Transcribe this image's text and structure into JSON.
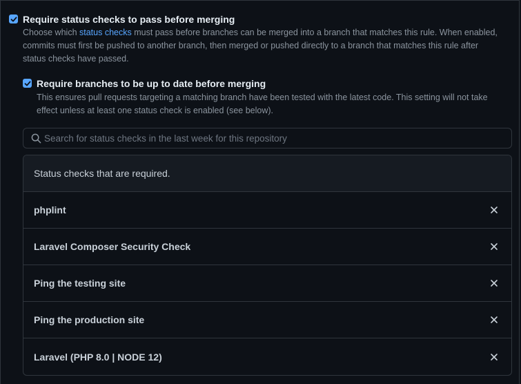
{
  "require_status_checks": {
    "checked": true,
    "title": "Require status checks to pass before merging",
    "desc_prefix": "Choose which ",
    "desc_link": "status checks",
    "desc_line1_rest": " must pass before branches can be merged into a branch that matches this rule. When enabled,",
    "desc_line2": "commits must first be pushed to another branch, then merged or pushed directly to a branch that matches this rule after",
    "desc_line3": "status checks have passed."
  },
  "require_up_to_date": {
    "checked": true,
    "title": "Require branches to be up to date before merging",
    "desc_line1": "This ensures pull requests targeting a matching branch have been tested with the latest code. This setting will not take",
    "desc_line2": "effect unless at least one status check is enabled (see below)."
  },
  "search": {
    "placeholder": "Search for status checks in the last week for this repository",
    "value": ""
  },
  "checks": {
    "header": "Status checks that are required.",
    "items": [
      {
        "name": "phplint"
      },
      {
        "name": "Laravel Composer Security Check"
      },
      {
        "name": "Ping the testing site"
      },
      {
        "name": "Ping the production site"
      },
      {
        "name": "Laravel (PHP 8.0 | NODE 12)"
      }
    ]
  },
  "colors": {
    "background": "#0d1117",
    "accent": "#58a6ff",
    "border": "#30363d",
    "muted_text": "#8b949e"
  }
}
